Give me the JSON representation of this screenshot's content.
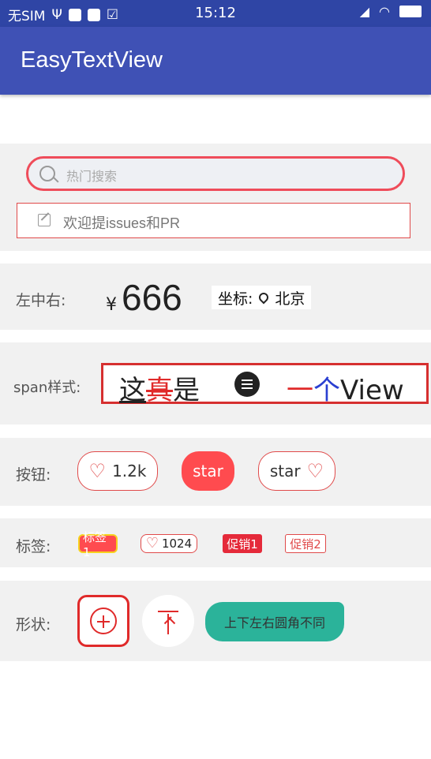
{
  "status_bar": {
    "carrier": "无SIM",
    "time": "15:12"
  },
  "app_bar": {
    "title": "EasyTextView"
  },
  "search": {
    "placeholder": "热门搜索"
  },
  "issues": {
    "text": "欢迎提issues和PR"
  },
  "row_lcr": {
    "label": "左中右:",
    "currency": "¥",
    "price": "666",
    "coord_label": "坐标:",
    "city": "北京"
  },
  "row_span": {
    "label": "span样式:",
    "part1_a": "这",
    "part1_b": "真",
    "part1_c": "是",
    "part2_a": "一",
    "part2_b": "个",
    "part2_c": "View"
  },
  "row_buttons": {
    "label": "按钮:",
    "like_count": "1.2k",
    "star_fill": "star",
    "star_outline": "star"
  },
  "row_tags": {
    "label": "标签:",
    "tag1": "标签1",
    "tag2": "1024",
    "tag3": "促销1",
    "tag4": "促销2"
  },
  "row_shapes": {
    "label": "形状:",
    "rounded_text": "上下左右圆角不同"
  },
  "colors": {
    "primary": "#3f51b5",
    "primary_dark": "#2f45a5",
    "accent_red": "#ff4b4f",
    "teal": "#2bb39a"
  }
}
